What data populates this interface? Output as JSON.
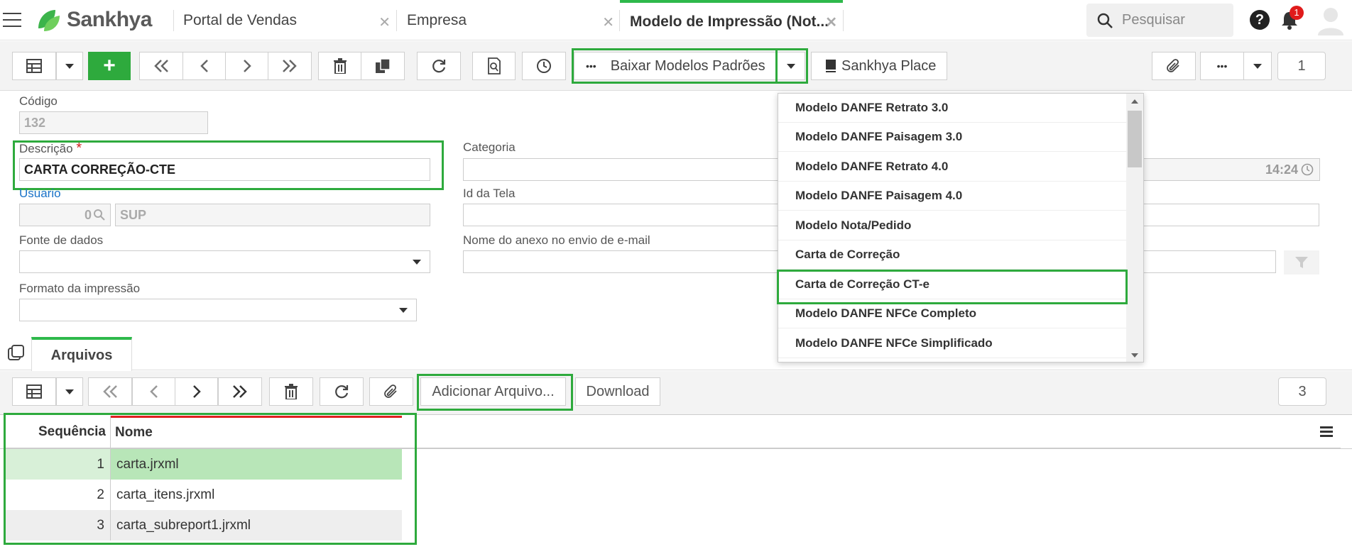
{
  "topbar": {
    "logo_text": "Sankhya",
    "tabs": [
      {
        "label": "Portal de Vendas"
      },
      {
        "label": "Empresa"
      },
      {
        "label": "Modelo de Impressão (Not..."
      }
    ],
    "close_glyph": "✕",
    "search_placeholder": "Pesquisar",
    "help_glyph": "?",
    "notification_count": "1"
  },
  "toolbar": {
    "add_glyph": "+",
    "baixar_label": "Baixar Modelos Padrões",
    "more_glyph": "•••",
    "sankhya_place_label": "Sankhya Place",
    "page_number": "1"
  },
  "form": {
    "codigo_label": "Código",
    "codigo_value": "132",
    "descricao_label": "Descrição",
    "required_mark": "*",
    "descricao_value": "CARTA CORREÇÃO-CTE",
    "categoria_label": "Categoria",
    "usuario_label": "Usuario",
    "usuario_code": "0",
    "usuario_name": "SUP",
    "id_tela_label": "Id da Tela",
    "fonte_label": "Fonte de dados",
    "nome_anexo_label": "Nome do anexo no envio de e-mail",
    "formato_label": "Formato da impressão",
    "time_value": "14:24"
  },
  "dropdown": {
    "items": [
      "Modelo DANFE Retrato 3.0",
      "Modelo DANFE Paisagem 3.0",
      "Modelo DANFE Retrato 4.0",
      "Modelo DANFE Paisagem 4.0",
      "Modelo Nota/Pedido",
      "Carta de Correção",
      "Carta de Correção CT-e",
      "Modelo DANFE NFCe Completo",
      "Modelo DANFE NFCe Simplificado"
    ],
    "selected": "Carta de Correção CT-e"
  },
  "detail": {
    "tab_label": "Arquivos",
    "adicionar_label": "Adicionar Arquivo...",
    "download_label": "Download",
    "record_count": "3",
    "columns": [
      "Sequência",
      "Nome"
    ],
    "rows": [
      {
        "seq": "1",
        "name": "carta.jrxml"
      },
      {
        "seq": "2",
        "name": "carta_itens.jrxml"
      },
      {
        "seq": "3",
        "name": "carta_subreport1.jrxml"
      }
    ]
  },
  "colors": {
    "accent_green": "#2eaa3d",
    "highlight_row": "#b8e6b8",
    "link_blue": "#1a73c8"
  }
}
